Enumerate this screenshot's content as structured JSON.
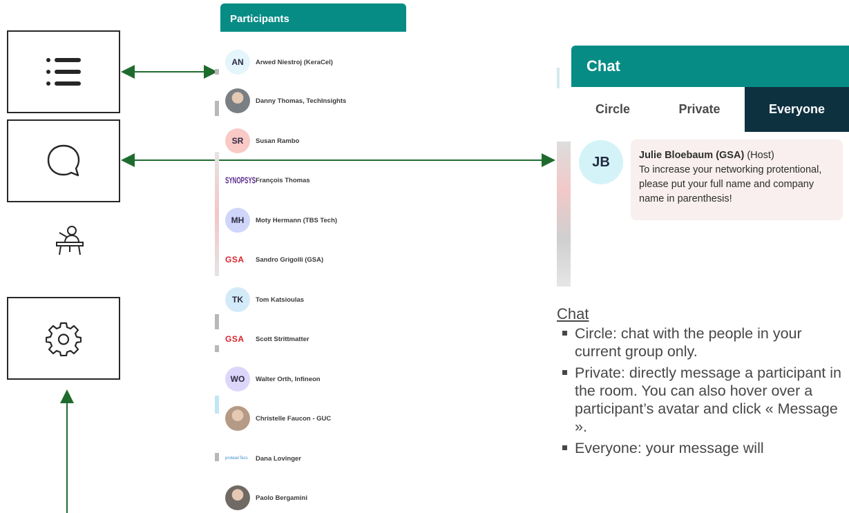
{
  "colors": {
    "teal": "#078c85",
    "dark_tab": "#0e3140",
    "arrow": "#1e6b2e",
    "bubble": "#f8efee"
  },
  "sidebar_icons": [
    {
      "name": "list-icon",
      "label": "Participants list"
    },
    {
      "name": "chat-bubble-icon",
      "label": "Chat"
    },
    {
      "name": "presenter-icon",
      "label": "Presenter"
    },
    {
      "name": "gear-icon",
      "label": "Settings"
    }
  ],
  "participants": {
    "title": "Participants",
    "items": [
      {
        "initials": "AN",
        "name": "Arwed Niestroj (KeraCel)",
        "avatar_type": "initials",
        "color": "#e4f5fb"
      },
      {
        "initials": "",
        "name": "Danny Thomas, TechInsights",
        "avatar_type": "photo",
        "color": "#7a7f84"
      },
      {
        "initials": "SR",
        "name": "Susan Rambo",
        "avatar_type": "initials",
        "color": "#f9c9c6"
      },
      {
        "initials": "",
        "name": "François Thomas",
        "avatar_type": "logo",
        "logo_text": "SYNOPSYS",
        "color": "#5b2b8c"
      },
      {
        "initials": "MH",
        "name": "Moty Hermann (TBS Tech)",
        "avatar_type": "initials",
        "color": "#cfd6fa"
      },
      {
        "initials": "",
        "name": "Sandro Grigolli (GSA)",
        "avatar_type": "logo",
        "logo_text": "GSA",
        "color": "#d9232e"
      },
      {
        "initials": "TK",
        "name": "Tom Katsioulas",
        "avatar_type": "initials",
        "color": "#d3eaf9"
      },
      {
        "initials": "",
        "name": "Scott Strittmatter",
        "avatar_type": "logo",
        "logo_text": "GSA",
        "color": "#d9232e"
      },
      {
        "initials": "WO",
        "name": "Walter Orth, Infineon",
        "avatar_type": "initials",
        "color": "#ddd6fb"
      },
      {
        "initials": "",
        "name": "Christelle Faucon - GUC",
        "avatar_type": "photo",
        "color": "#b59a86"
      },
      {
        "initials": "",
        "name": "Dana Lovinger",
        "avatar_type": "logo",
        "logo_text": "proteanTecs",
        "color": "#3a8fd0"
      },
      {
        "initials": "",
        "name": "Paolo Bergamini",
        "avatar_type": "photo",
        "color": "#6f6a63"
      }
    ]
  },
  "chat": {
    "title": "Chat",
    "tabs": [
      {
        "label": "Circle",
        "active": false
      },
      {
        "label": "Private",
        "active": false
      },
      {
        "label": "Everyone",
        "active": true
      }
    ],
    "message": {
      "initials": "JB",
      "sender": "Julie Bloebaum (GSA)",
      "role": "(Host)",
      "text": "To increase your networking protentional, please put your full name and company name in parenthesis!"
    }
  },
  "explanation": {
    "heading": "Chat",
    "bullets": [
      "Circle: chat with the people in your current group only.",
      "Private: directly message a participant in the room. You can also hover over a participant’s avatar and click « Message ».",
      "Everyone: your message will"
    ]
  }
}
